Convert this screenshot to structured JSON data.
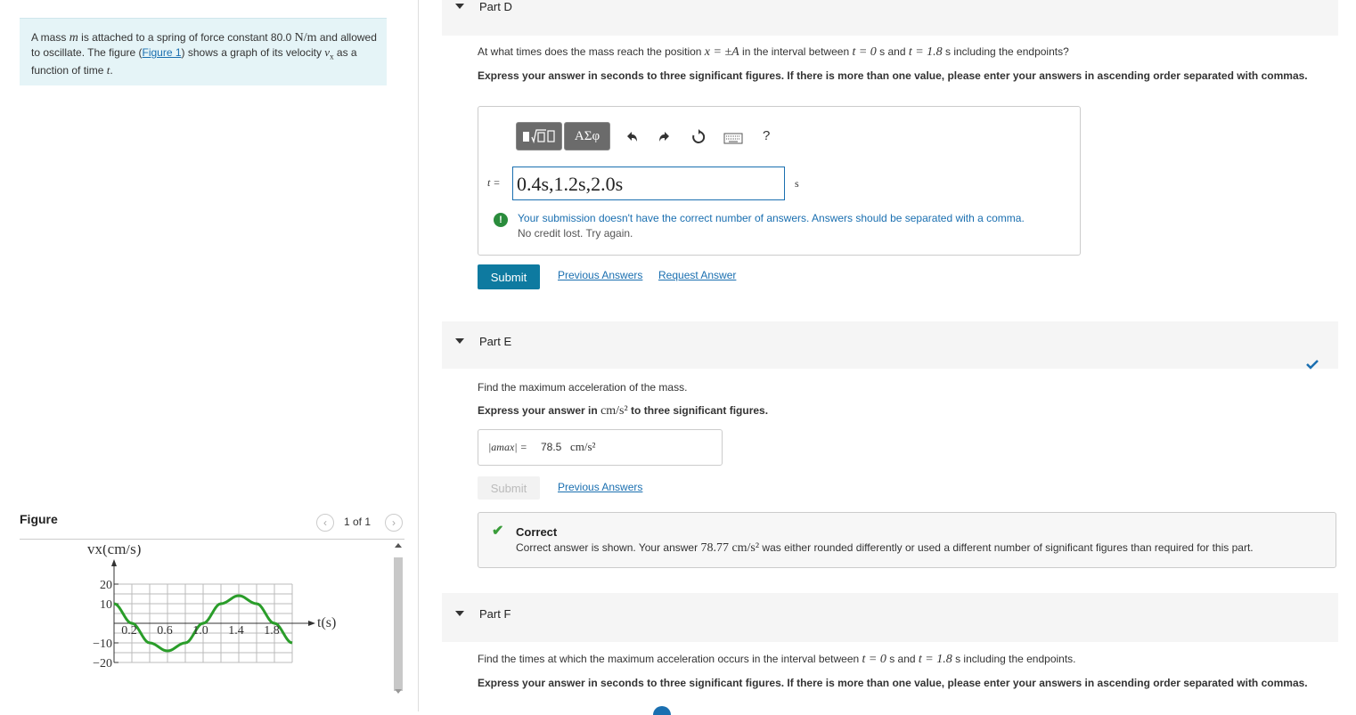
{
  "problem": {
    "p1": "A mass ",
    "p1_var": "m",
    "p2": " is attached to a spring of force constant 80.0 ",
    "p2_unit": "N/m",
    "p3": " and allowed to oscillate. The figure (",
    "figure_link": "Figure 1",
    "p4": ") shows a graph of its velocity ",
    "p4_var": "v",
    "p4_sub": "x",
    "p5": " as a function of time ",
    "p5_var": "t",
    "p6": "."
  },
  "figure": {
    "title": "Figure",
    "counter": "1 of 1",
    "prev_icon": "chevron-left-icon",
    "next_icon": "chevron-right-icon"
  },
  "chart_data": {
    "type": "line",
    "ylabel": "vx(cm/s)",
    "xlabel": "t(s)",
    "ylim": [
      -20,
      20
    ],
    "xlim": [
      0,
      2.0
    ],
    "y_ticks": [
      "20",
      "10",
      "−10",
      "−20"
    ],
    "x_ticks": [
      "0.2",
      "0.6",
      "1.0",
      "1.4",
      "1.8"
    ],
    "grid": true,
    "series": [
      {
        "x": [
          0,
          0.2,
          0.4,
          0.6,
          0.8,
          1.0,
          1.2,
          1.4,
          1.6,
          1.8,
          2.0
        ],
        "values": [
          10,
          0,
          -10,
          -14.1,
          -10,
          0,
          10,
          14.1,
          10,
          0,
          -10
        ],
        "color": "#2a9d2a"
      }
    ]
  },
  "partD": {
    "title": "Part D",
    "question_a": "At what times does the mass reach the position ",
    "question_math1": "x = ±A",
    "question_b": " in the interval between ",
    "question_math2": "t = 0",
    "question_c": " s and ",
    "question_math3": "t = 1.8",
    "question_d": " s including the endpoints?",
    "instructions": "Express your answer in seconds to three significant figures. If there is more than one value, please enter your answers in ascending order separated with commas.",
    "toolbar": {
      "templates": "templates-icon",
      "greek": "ΑΣφ",
      "undo": "undo-icon",
      "redo": "redo-icon",
      "reset": "reset-icon",
      "keyboard": "keyboard-icon",
      "help": "?"
    },
    "var_label": "t =",
    "answer_value": "0.4s,1.2s,2.0s",
    "unit": "s",
    "feedback_line1": "Your submission doesn't have the correct number of answers. Answers should be separated with a comma.",
    "feedback_line2": "No credit lost. Try again.",
    "submit": "Submit",
    "previous_answers": "Previous Answers",
    "request_answer": "Request Answer"
  },
  "partE": {
    "title": "Part E",
    "question": "Find the maximum acceleration of the mass.",
    "instr_a": "Express your answer in ",
    "instr_unit": "cm/s²",
    "instr_b": " to three significant figures.",
    "answer_label": "|amax| =",
    "answer_value": "78.5",
    "answer_unit": "cm/s²",
    "submit": "Submit",
    "previous_answers": "Previous Answers",
    "correct_title": "Correct",
    "correct_a": "Correct answer is shown. Your answer ",
    "correct_val": "78.77 cm/s²",
    "correct_b": " was either rounded differently or used a different number of significant figures than required for this part."
  },
  "partF": {
    "title": "Part F",
    "question_a": "Find the times at which the maximum acceleration occurs in the interval between ",
    "question_math1": "t = 0",
    "question_b": " s and ",
    "question_math2": "t = 1.8",
    "question_c": " s including the endpoints.",
    "instructions": "Express your answer in seconds to three significant figures. If there is more than one value, please enter your answers in ascending order separated with commas."
  }
}
